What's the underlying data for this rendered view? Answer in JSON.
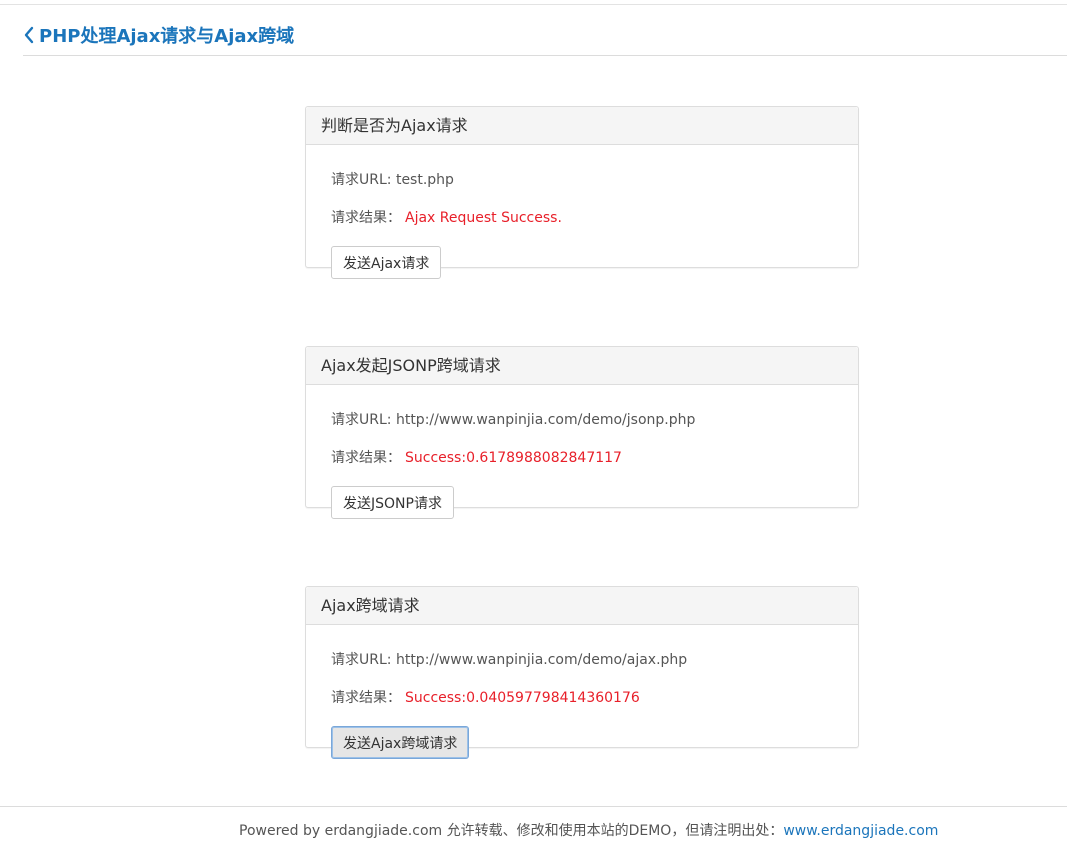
{
  "header": {
    "title": "PHP处理Ajax请求与Ajax跨域"
  },
  "panels": [
    {
      "title": "判断是否为Ajax请求",
      "url_label": "请求URL: ",
      "url": "test.php",
      "result_label": "请求结果：",
      "result": "Ajax Request Success.",
      "button_label": "发送Ajax请求"
    },
    {
      "title": "Ajax发起JSONP跨域请求",
      "url_label": "请求URL: ",
      "url": "http://www.wanpinjia.com/demo/jsonp.php",
      "result_label": "请求结果：",
      "result": "Success:0.6178988082847117",
      "button_label": "发送JSONP请求"
    },
    {
      "title": "Ajax跨域请求",
      "url_label": "请求URL: ",
      "url": "http://www.wanpinjia.com/demo/ajax.php",
      "result_label": "请求结果：",
      "result": "Success:0.040597798414360176",
      "button_label": "发送Ajax跨域请求"
    }
  ],
  "footer": {
    "text": "Powered by erdangjiade.com 允许转载、修改和使用本站的DEMO，但请注明出处：",
    "link": "www.erdangjiade.com"
  },
  "colors": {
    "accent": "#1b75bb",
    "result": "#e8202a"
  },
  "icons": {
    "back": "chevron-left-icon"
  }
}
